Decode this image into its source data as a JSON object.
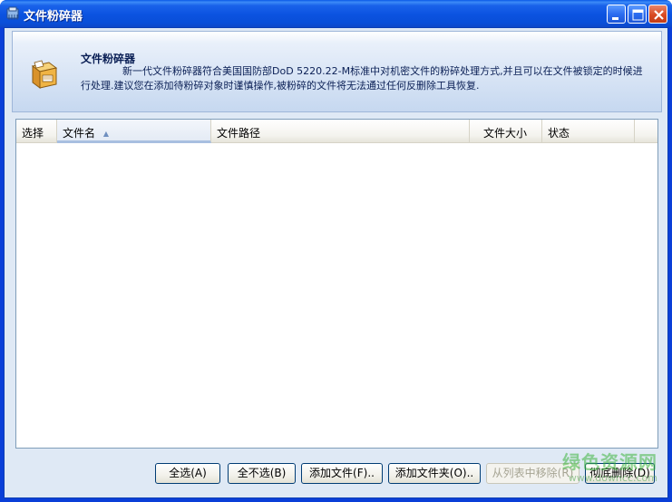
{
  "window": {
    "title": "文件粉碎器",
    "controls": [
      "minimize",
      "maximize",
      "close"
    ]
  },
  "header": {
    "icon": "shredder-box-icon",
    "title": "文件粉碎器",
    "description": "新一代文件粉碎器符合美国国防部DoD 5220.22-M标准中对机密文件的粉碎处理方式,并且可以在文件被锁定的时候进行处理.建议您在添加待粉碎对象时谨慎操作,被粉碎的文件将无法通过任何反删除工具恢复."
  },
  "list": {
    "columns": [
      {
        "label": "选择"
      },
      {
        "label": "文件名",
        "sorted": "ascending"
      },
      {
        "label": "文件路径"
      },
      {
        "label": "文件大小"
      },
      {
        "label": "状态"
      }
    ],
    "rows": []
  },
  "buttons": {
    "select_all": "全选(A)",
    "select_none": "全不选(B)",
    "add_file": "添加文件(F)..",
    "add_folder": "添加文件夹(O)..",
    "remove_from_list": "从列表中移除(R)",
    "shred": "彻底删除(D)"
  },
  "watermark": {
    "main": "绿色资源网",
    "sub": "www.downcc.com"
  },
  "colors": {
    "titlebar": "#0a4fd8",
    "client_bg": "#dfe9f5",
    "watermark": "#3cb43c"
  }
}
